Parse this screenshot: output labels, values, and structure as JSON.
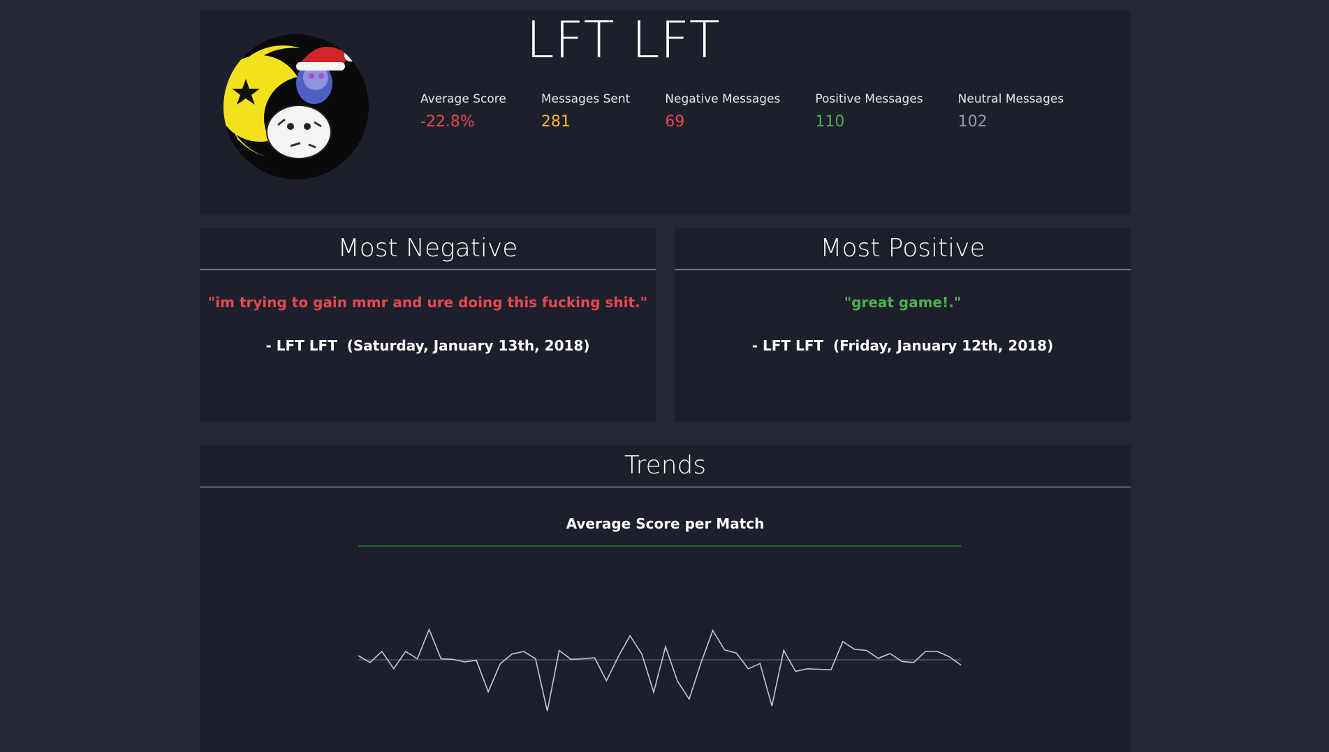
{
  "header": {
    "player_name": "LFT LFT",
    "stats": [
      {
        "label": "Average Score",
        "value": "-22.8%",
        "color": "#e6484f"
      },
      {
        "label": "Messages Sent",
        "value": "281",
        "color": "#f5b82e"
      },
      {
        "label": "Negative Messages",
        "value": "69",
        "color": "#e6484f"
      },
      {
        "label": "Positive Messages",
        "value": "110",
        "color": "#4caf50"
      },
      {
        "label": "Neutral Messages",
        "value": "102",
        "color": "#9a9aa4"
      }
    ]
  },
  "most_negative": {
    "title": "Most Negative",
    "quote": "\"im trying to gain mmr and ure doing this fucking shit.\"",
    "author": "- LFT LFT  (Saturday, January 13th, 2018)",
    "color": "#e6484f"
  },
  "most_positive": {
    "title": "Most Positive",
    "quote": "\"great game!.\"",
    "author": "- LFT LFT  (Friday, January 12th, 2018)",
    "color": "#4caf50"
  },
  "trends": {
    "title": "Trends",
    "chart_data": {
      "type": "line",
      "title": "Average Score per Match",
      "xlabel": "",
      "ylabel": "",
      "grid": false,
      "ylim": [
        -1,
        1
      ],
      "baseline": 0,
      "title_rule_color": "#2e7d32",
      "line_color": "#c8c8d0",
      "values": [
        0.08,
        -0.05,
        0.16,
        -0.17,
        0.16,
        0.02,
        0.58,
        0.02,
        0.01,
        -0.04,
        -0.01,
        -0.61,
        -0.08,
        0.11,
        0.16,
        0.02,
        -0.98,
        0.18,
        0.01,
        0.02,
        0.04,
        -0.4,
        0.06,
        0.46,
        0.11,
        -0.62,
        0.25,
        -0.4,
        -0.75,
        -0.06,
        0.56,
        0.19,
        0.13,
        -0.17,
        -0.07,
        -0.88,
        0.18,
        -0.22,
        -0.17,
        -0.18,
        -0.19,
        0.35,
        0.2,
        0.18,
        0.03,
        0.12,
        -0.03,
        -0.05,
        0.16,
        0.16,
        0.06,
        -0.1
      ]
    }
  }
}
